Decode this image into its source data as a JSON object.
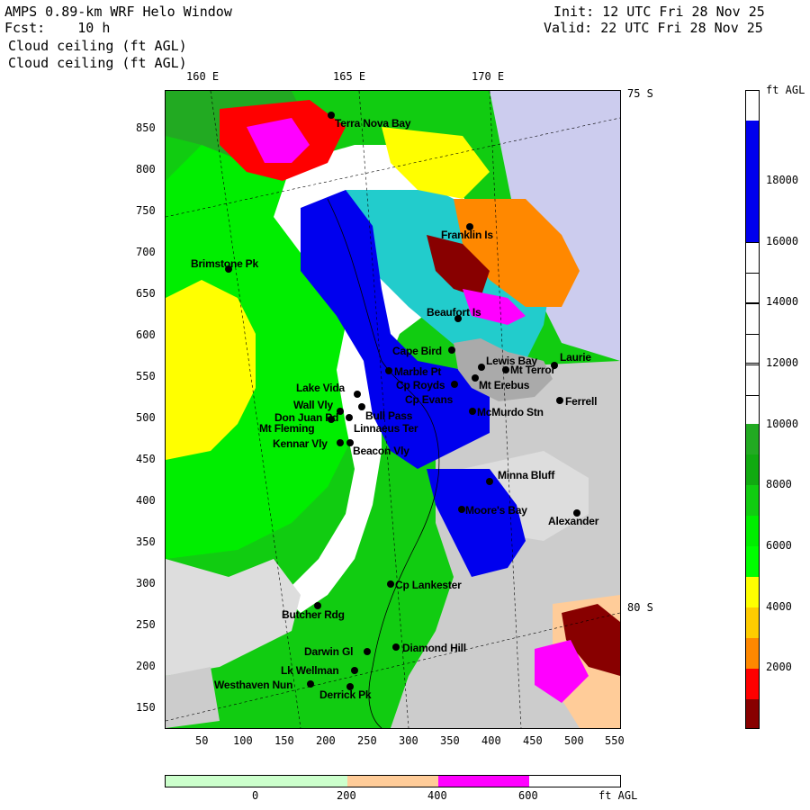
{
  "header": {
    "title_left": "AMPS 0.89-km WRF Helo Window",
    "fcst_label": "Fcst:",
    "fcst_value": "10 h",
    "field_line1": "Cloud ceiling (ft AGL)",
    "field_line2": "Cloud ceiling (ft AGL)",
    "init": "Init: 12 UTC Fri 28 Nov 25",
    "valid": "Valid: 22 UTC Fri 28 Nov 25"
  },
  "longitude_labels": [
    "160 E",
    "165 E",
    "170 E"
  ],
  "latitude_labels": [
    "75 S",
    "80 S"
  ],
  "y_axis_ticks": [
    "850",
    "800",
    "750",
    "700",
    "650",
    "600",
    "550",
    "500",
    "450",
    "400",
    "350",
    "300",
    "250",
    "200",
    "150"
  ],
  "x_axis_ticks": [
    "50",
    "100",
    "150",
    "200",
    "250",
    "300",
    "350",
    "400",
    "450",
    "500",
    "550"
  ],
  "stations": [
    {
      "name": "Terra Nova Bay"
    },
    {
      "name": "Franklin Is"
    },
    {
      "name": "Brimstone Pk"
    },
    {
      "name": "Beaufort Is"
    },
    {
      "name": "Cape Bird"
    },
    {
      "name": "Lewis Bay"
    },
    {
      "name": "Laurie"
    },
    {
      "name": "Mt Terror"
    },
    {
      "name": "Marble Pt"
    },
    {
      "name": "Cp Royds"
    },
    {
      "name": "Mt Erebus"
    },
    {
      "name": "Lake Vida"
    },
    {
      "name": "Cp Evans"
    },
    {
      "name": "Wall Vly"
    },
    {
      "name": "Bull Pass"
    },
    {
      "name": "McMurdo Stn"
    },
    {
      "name": "Ferrell"
    },
    {
      "name": "Don Juan Pd"
    },
    {
      "name": "Mt Fleming"
    },
    {
      "name": "Linnaeus Ter"
    },
    {
      "name": "Kennar Vly"
    },
    {
      "name": "Beacon Vly"
    },
    {
      "name": "Minna Bluff"
    },
    {
      "name": "Moore's Bay"
    },
    {
      "name": "Alexander"
    },
    {
      "name": "Cp Lankester"
    },
    {
      "name": "Butcher Rdg"
    },
    {
      "name": "Darwin Gl"
    },
    {
      "name": "Diamond Hill"
    },
    {
      "name": "Lk Wellman"
    },
    {
      "name": "Westhaven Nun"
    },
    {
      "name": "Derrick Pk"
    }
  ],
  "colorbar": {
    "unit": "ft AGL",
    "labels": [
      "18000",
      "16000",
      "14000",
      "12000",
      "10000",
      "8000",
      "6000",
      "4000",
      "2000"
    ],
    "colors": [
      "#ffffff",
      "#0000ee",
      "#ffffff",
      "#ffffff",
      "#ffffff",
      "#ffffff",
      "#22aa22",
      "#11cc11",
      "#00ee00",
      "#00ff00",
      "#ffff00",
      "#ffcc00",
      "#ff8800",
      "#ff0000",
      "#880000"
    ]
  },
  "bottom_bar": {
    "labels": [
      "0",
      "200",
      "400",
      "600"
    ],
    "unit": "ft AGL",
    "colors": [
      "#ccffcc",
      "#ccffcc",
      "#ffcc99",
      "#ff00ff",
      "#ffffff"
    ]
  }
}
